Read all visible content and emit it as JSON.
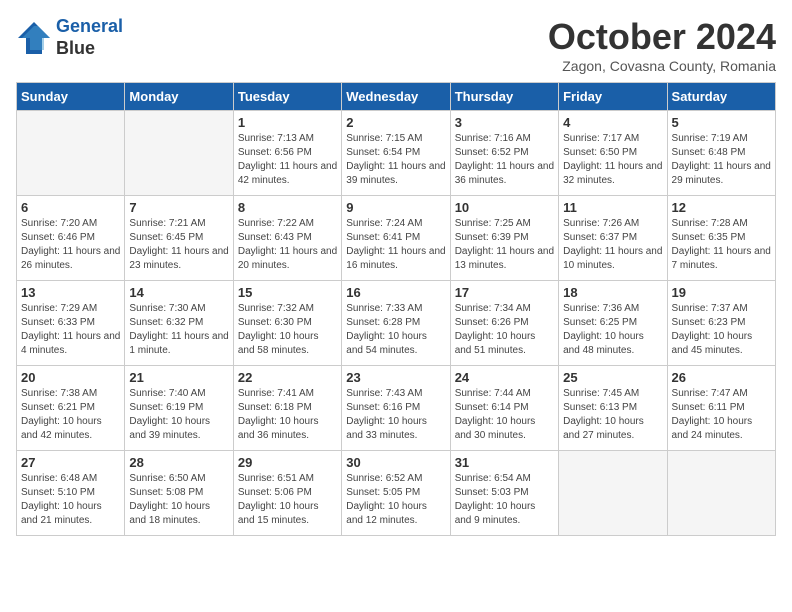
{
  "header": {
    "logo_line1": "General",
    "logo_line2": "Blue",
    "month": "October 2024",
    "location": "Zagon, Covasna County, Romania"
  },
  "weekdays": [
    "Sunday",
    "Monday",
    "Tuesday",
    "Wednesday",
    "Thursday",
    "Friday",
    "Saturday"
  ],
  "weeks": [
    [
      {
        "day": "",
        "empty": true
      },
      {
        "day": "",
        "empty": true
      },
      {
        "day": "1",
        "sunrise": "7:13 AM",
        "sunset": "6:56 PM",
        "daylight": "11 hours and 42 minutes."
      },
      {
        "day": "2",
        "sunrise": "7:15 AM",
        "sunset": "6:54 PM",
        "daylight": "11 hours and 39 minutes."
      },
      {
        "day": "3",
        "sunrise": "7:16 AM",
        "sunset": "6:52 PM",
        "daylight": "11 hours and 36 minutes."
      },
      {
        "day": "4",
        "sunrise": "7:17 AM",
        "sunset": "6:50 PM",
        "daylight": "11 hours and 32 minutes."
      },
      {
        "day": "5",
        "sunrise": "7:19 AM",
        "sunset": "6:48 PM",
        "daylight": "11 hours and 29 minutes."
      }
    ],
    [
      {
        "day": "6",
        "sunrise": "7:20 AM",
        "sunset": "6:46 PM",
        "daylight": "11 hours and 26 minutes."
      },
      {
        "day": "7",
        "sunrise": "7:21 AM",
        "sunset": "6:45 PM",
        "daylight": "11 hours and 23 minutes."
      },
      {
        "day": "8",
        "sunrise": "7:22 AM",
        "sunset": "6:43 PM",
        "daylight": "11 hours and 20 minutes."
      },
      {
        "day": "9",
        "sunrise": "7:24 AM",
        "sunset": "6:41 PM",
        "daylight": "11 hours and 16 minutes."
      },
      {
        "day": "10",
        "sunrise": "7:25 AM",
        "sunset": "6:39 PM",
        "daylight": "11 hours and 13 minutes."
      },
      {
        "day": "11",
        "sunrise": "7:26 AM",
        "sunset": "6:37 PM",
        "daylight": "11 hours and 10 minutes."
      },
      {
        "day": "12",
        "sunrise": "7:28 AM",
        "sunset": "6:35 PM",
        "daylight": "11 hours and 7 minutes."
      }
    ],
    [
      {
        "day": "13",
        "sunrise": "7:29 AM",
        "sunset": "6:33 PM",
        "daylight": "11 hours and 4 minutes."
      },
      {
        "day": "14",
        "sunrise": "7:30 AM",
        "sunset": "6:32 PM",
        "daylight": "11 hours and 1 minute."
      },
      {
        "day": "15",
        "sunrise": "7:32 AM",
        "sunset": "6:30 PM",
        "daylight": "10 hours and 58 minutes."
      },
      {
        "day": "16",
        "sunrise": "7:33 AM",
        "sunset": "6:28 PM",
        "daylight": "10 hours and 54 minutes."
      },
      {
        "day": "17",
        "sunrise": "7:34 AM",
        "sunset": "6:26 PM",
        "daylight": "10 hours and 51 minutes."
      },
      {
        "day": "18",
        "sunrise": "7:36 AM",
        "sunset": "6:25 PM",
        "daylight": "10 hours and 48 minutes."
      },
      {
        "day": "19",
        "sunrise": "7:37 AM",
        "sunset": "6:23 PM",
        "daylight": "10 hours and 45 minutes."
      }
    ],
    [
      {
        "day": "20",
        "sunrise": "7:38 AM",
        "sunset": "6:21 PM",
        "daylight": "10 hours and 42 minutes."
      },
      {
        "day": "21",
        "sunrise": "7:40 AM",
        "sunset": "6:19 PM",
        "daylight": "10 hours and 39 minutes."
      },
      {
        "day": "22",
        "sunrise": "7:41 AM",
        "sunset": "6:18 PM",
        "daylight": "10 hours and 36 minutes."
      },
      {
        "day": "23",
        "sunrise": "7:43 AM",
        "sunset": "6:16 PM",
        "daylight": "10 hours and 33 minutes."
      },
      {
        "day": "24",
        "sunrise": "7:44 AM",
        "sunset": "6:14 PM",
        "daylight": "10 hours and 30 minutes."
      },
      {
        "day": "25",
        "sunrise": "7:45 AM",
        "sunset": "6:13 PM",
        "daylight": "10 hours and 27 minutes."
      },
      {
        "day": "26",
        "sunrise": "7:47 AM",
        "sunset": "6:11 PM",
        "daylight": "10 hours and 24 minutes."
      }
    ],
    [
      {
        "day": "27",
        "sunrise": "6:48 AM",
        "sunset": "5:10 PM",
        "daylight": "10 hours and 21 minutes."
      },
      {
        "day": "28",
        "sunrise": "6:50 AM",
        "sunset": "5:08 PM",
        "daylight": "10 hours and 18 minutes."
      },
      {
        "day": "29",
        "sunrise": "6:51 AM",
        "sunset": "5:06 PM",
        "daylight": "10 hours and 15 minutes."
      },
      {
        "day": "30",
        "sunrise": "6:52 AM",
        "sunset": "5:05 PM",
        "daylight": "10 hours and 12 minutes."
      },
      {
        "day": "31",
        "sunrise": "6:54 AM",
        "sunset": "5:03 PM",
        "daylight": "10 hours and 9 minutes."
      },
      {
        "day": "",
        "empty": true
      },
      {
        "day": "",
        "empty": true
      }
    ]
  ]
}
